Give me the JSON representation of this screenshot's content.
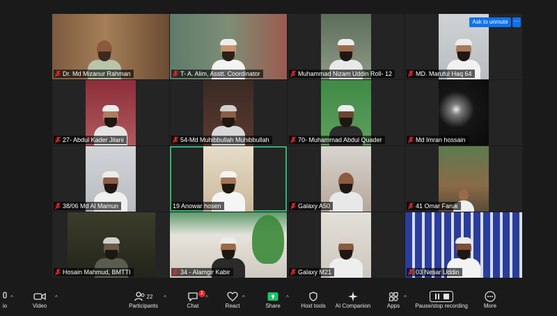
{
  "colors": {
    "background": "#1a1a1a",
    "active_speaker": "#2fb57a",
    "unmute_button": "#0e72ed",
    "mute_icon": "#e02828",
    "share_icon": "#21c16b"
  },
  "participants": [
    {
      "name": "Dr. Md Mizanur Rahman",
      "muted": true
    },
    {
      "name": "T- A. Alim, Asstt. Coordinator",
      "muted": true
    },
    {
      "name": "Muhammad Nizam Uddin Roll- 12",
      "muted": true
    },
    {
      "name": "MD. Maruful Haq 64",
      "muted": true
    },
    {
      "name": "27- Abdul Kader Jilani",
      "muted": true
    },
    {
      "name": "54-Md Muhibbullah Muhibbullah",
      "muted": true
    },
    {
      "name": "70- Muhammad Abdul Quader",
      "muted": true
    },
    {
      "name": "Md Imran hossain",
      "muted": true
    },
    {
      "name": "38/06 Md Al Mamun",
      "muted": true
    },
    {
      "name": "19 Anowar hosen",
      "muted": false
    },
    {
      "name": "Galaxy A50",
      "muted": true
    },
    {
      "name": "41 Omar Faruk",
      "muted": true
    },
    {
      "name": "Hosain Mahmud, BMTTI",
      "muted": true
    },
    {
      "name": "34 - Alamgir Kabir",
      "muted": true
    },
    {
      "name": "Galaxy M21",
      "muted": true
    },
    {
      "name": "03 Nesar Uddin",
      "muted": true
    }
  ],
  "overlay": {
    "unmute_label": "Ask to unmute",
    "more_label": "···"
  },
  "toolbar": {
    "audio_label": "io",
    "video_label": "Video",
    "participants_label": "Participants",
    "participants_count": "22",
    "chat_label": "Chat",
    "chat_badge": "2",
    "react_label": "React",
    "share_label": "Share",
    "host_tools_label": "Host tools",
    "ai_label": "AI Companion",
    "apps_label": "Apps",
    "record_label": "Pause/stop recording",
    "more_label": "More"
  }
}
